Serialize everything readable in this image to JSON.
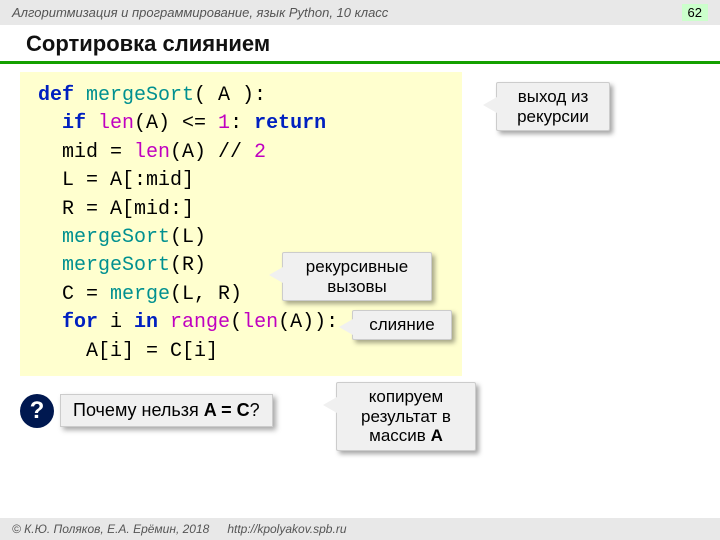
{
  "header": {
    "course": "Алгоритмизация и программирование, язык Python, 10 класс",
    "page": "62"
  },
  "title": "Сортировка слиянием",
  "callouts": {
    "exit": "выход из рекурсии",
    "recursive": "рекурсивные вызовы",
    "merge": "слияние",
    "copy_l1": "копируем результат в массив ",
    "copy_bold": "A"
  },
  "question": {
    "mark": "?",
    "text_pre": "  Почему нельзя ",
    "text_bold": "A = C",
    "text_post": "?"
  },
  "footer": {
    "copyright": "© К.Ю. Поляков, Е.А. Ерёмин, 2018",
    "url": "http://kpolyakov.spb.ru"
  },
  "code": {
    "l1a": "def",
    "l1b": " mergeSort",
    "l1c": "( A ):",
    "l2a": "  if",
    "l2b": " len",
    "l2c": "(A) <= ",
    "l2d": "1",
    "l2e": ": ",
    "l2f": "return",
    "l3a": "  mid = ",
    "l3b": "len",
    "l3c": "(A) // ",
    "l3d": "2",
    "l4": "  L = A[:mid]",
    "l5": "  R = A[mid:]",
    "l6a": "  ",
    "l6b": "mergeSort",
    "l6c": "(L)",
    "l7a": "  ",
    "l7b": "mergeSort",
    "l7c": "(R)",
    "l8a": "  C = ",
    "l8b": "merge",
    "l8c": "(L, R)",
    "l9a": "  for",
    "l9b": " i ",
    "l9c": "in",
    "l9d": " range",
    "l9e": "(",
    "l9f": "len",
    "l9g": "(A)):",
    "l10": "    A[i] = C[i]"
  }
}
